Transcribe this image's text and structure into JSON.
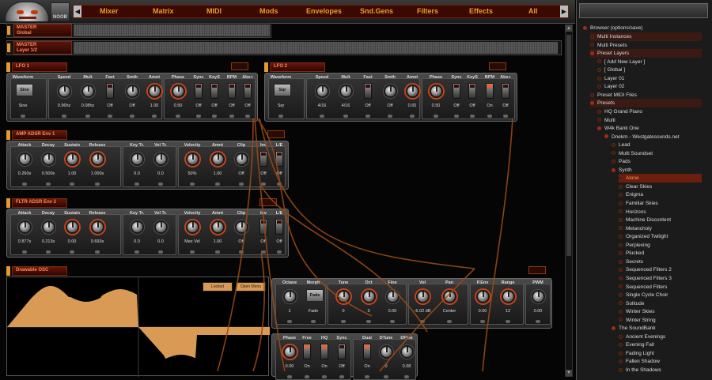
{
  "nav": {
    "items": [
      "Mixer",
      "Matrix",
      "MIDI",
      "Mods",
      "Envelopes",
      "Snd.Gens",
      "Filters",
      "Effects",
      "All"
    ],
    "logo2": "NOOB"
  },
  "master_global": {
    "line1": "MASTER",
    "line2": "Global"
  },
  "master_layer": {
    "line1": "MASTER",
    "line2": "Layer 1/2"
  },
  "lfo1": {
    "title": "LFO 1",
    "controls": [
      {
        "label": "Waveform",
        "value": "Sine",
        "button": "Sine"
      },
      {
        "label": "Speed",
        "value": "0.96hz"
      },
      {
        "label": "Mult",
        "value": "0.08hz"
      },
      {
        "label": "Fast",
        "value": "Off"
      },
      {
        "label": "Smth",
        "value": "Off"
      },
      {
        "label": "Amnt",
        "value": "1.00"
      },
      {
        "label": "Phase",
        "value": "0.50"
      },
      {
        "label": "Sync",
        "value": "Off"
      },
      {
        "label": "KeyS",
        "value": "Off"
      },
      {
        "label": "BPM",
        "value": "Off"
      },
      {
        "label": "Abs+",
        "value": "Off"
      }
    ]
  },
  "lfo2": {
    "title": "LFO 2",
    "controls": [
      {
        "label": "Waveform",
        "value": "Sqr",
        "button": "Sqr"
      },
      {
        "label": "Speed",
        "value": "4/16"
      },
      {
        "label": "Mult",
        "value": "4/16"
      },
      {
        "label": "Fast",
        "value": "Off"
      },
      {
        "label": "Smth",
        "value": "Off"
      },
      {
        "label": "Amnt",
        "value": "0.65"
      },
      {
        "label": "Phase",
        "value": "0.50"
      },
      {
        "label": "Sync",
        "value": "Off"
      },
      {
        "label": "KeyS",
        "value": "Off"
      },
      {
        "label": "BPM",
        "value": "On"
      },
      {
        "label": "Abs+",
        "value": "Off"
      }
    ]
  },
  "amp": {
    "title": "AMP ADSR Env 1",
    "controls": [
      {
        "label": "Attack",
        "value": "0.260s"
      },
      {
        "label": "Decay",
        "value": "0.500s"
      },
      {
        "label": "Sustain",
        "value": "1.00"
      },
      {
        "label": "Release",
        "value": "1.000s"
      },
      {
        "label": "Key Tr.",
        "value": "0.0"
      },
      {
        "label": "Vel Tr.",
        "value": "0.0"
      },
      {
        "label": "Velocity",
        "value": "50%"
      },
      {
        "label": "Amnt",
        "value": "1.00"
      },
      {
        "label": "Clip",
        "value": "Off"
      },
      {
        "label": "Inv",
        "value": "Off"
      },
      {
        "label": "L/E",
        "value": "Off"
      }
    ]
  },
  "fltr": {
    "title": "FLTR ADSR Env 2",
    "controls": [
      {
        "label": "Attack",
        "value": "0.877s"
      },
      {
        "label": "Decay",
        "value": "0.213s"
      },
      {
        "label": "Sustain",
        "value": "0.00"
      },
      {
        "label": "Release",
        "value": "0.693s"
      },
      {
        "label": "Key Tr.",
        "value": "0.0"
      },
      {
        "label": "Vel Tr.",
        "value": "0.0"
      },
      {
        "label": "Velocity",
        "value": "Max Vel"
      },
      {
        "label": "Amnt",
        "value": "1.00"
      },
      {
        "label": "Clip",
        "value": "Off"
      },
      {
        "label": "Inv",
        "value": "Off"
      },
      {
        "label": "L/E",
        "value": "Off"
      }
    ]
  },
  "drawable": {
    "title": "Drawable OSC",
    "locked": "Locked",
    "open_menu": "Open Menu",
    "waveform_color": "#d99a55",
    "osc_controls": [
      {
        "label": "Octave",
        "value": "1"
      },
      {
        "label": "Morph",
        "value": "Fade",
        "button": "Fade"
      },
      {
        "label": "Tune",
        "value": "0"
      },
      {
        "label": "Oct",
        "value": "3"
      },
      {
        "label": "Fine",
        "value": "0.00"
      },
      {
        "label": "Vol",
        "value": "-6.02 dB"
      },
      {
        "label": "Pan",
        "value": "Center"
      },
      {
        "label": "P.Env",
        "value": "0.00"
      },
      {
        "label": "Range",
        "value": "12"
      },
      {
        "label": "PWM",
        "value": "0.00"
      }
    ],
    "osc_controls2": [
      {
        "label": "Phase",
        "value": "0.00"
      },
      {
        "label": "Free",
        "value": "On"
      },
      {
        "label": "HQ",
        "value": "On"
      },
      {
        "label": "Sync",
        "value": "Off"
      },
      {
        "label": "Dual",
        "value": "On"
      },
      {
        "label": "DTune",
        "value": "0"
      },
      {
        "label": "DFine",
        "value": "0.08"
      }
    ]
  },
  "browser": {
    "title": "Browser (options/save)",
    "items": [
      {
        "text": "Multi Instances",
        "indent": 1,
        "open": false,
        "hl": true
      },
      {
        "text": "Multi Presets",
        "indent": 1,
        "open": false
      },
      {
        "text": "Preset Layers",
        "indent": 1,
        "open": true,
        "hl": true
      },
      {
        "text": "[ Add New Layer ]",
        "indent": 2,
        "open": false
      },
      {
        "text": "[ Global ]",
        "indent": 2,
        "open": false
      },
      {
        "text": "Layer 01",
        "indent": 2,
        "open": false
      },
      {
        "text": "Layer 02",
        "indent": 2,
        "open": false
      },
      {
        "text": "Preset MIDI Files",
        "indent": 1,
        "open": false
      },
      {
        "text": "Presets",
        "indent": 1,
        "open": true,
        "hl": true
      },
      {
        "text": "HQ Grand Piano",
        "indent": 2,
        "open": false
      },
      {
        "text": "Multi",
        "indent": 2,
        "open": false
      },
      {
        "text": "W4k Bank One",
        "indent": 2,
        "open": true
      },
      {
        "text": "Dnekm - Westgatesounds.net",
        "indent": 3,
        "open": true
      },
      {
        "text": "Lead",
        "indent": 4,
        "open": false
      },
      {
        "text": "Multi Soundset",
        "indent": 4,
        "open": false
      },
      {
        "text": "Pads",
        "indent": 4,
        "open": false
      },
      {
        "text": "Synth",
        "indent": 4,
        "open": true
      },
      {
        "text": "Alone",
        "indent": 5,
        "open": false,
        "sel": true
      },
      {
        "text": "Clear Skies",
        "indent": 5,
        "open": false
      },
      {
        "text": "Enigma",
        "indent": 5,
        "open": false
      },
      {
        "text": "Familiar Skies",
        "indent": 5,
        "open": false
      },
      {
        "text": "Horizons",
        "indent": 5,
        "open": false
      },
      {
        "text": "Machine Discontent",
        "indent": 5,
        "open": false
      },
      {
        "text": "Melancholy",
        "indent": 5,
        "open": false
      },
      {
        "text": "Organized Twilight",
        "indent": 5,
        "open": false
      },
      {
        "text": "Perplexing",
        "indent": 5,
        "open": false
      },
      {
        "text": "Plucked",
        "indent": 5,
        "open": false
      },
      {
        "text": "Secrets",
        "indent": 5,
        "open": false
      },
      {
        "text": "Sequenced Filters 2",
        "indent": 5,
        "open": false
      },
      {
        "text": "Sequenced Filters 3",
        "indent": 5,
        "open": false
      },
      {
        "text": "Sequenced Filters",
        "indent": 5,
        "open": false
      },
      {
        "text": "Single Cycle Choir",
        "indent": 5,
        "open": false
      },
      {
        "text": "Solitude",
        "indent": 5,
        "open": false
      },
      {
        "text": "Winter Skies",
        "indent": 5,
        "open": false
      },
      {
        "text": "Winter String",
        "indent": 5,
        "open": false
      },
      {
        "text": "The SoundBank",
        "indent": 4,
        "open": true
      },
      {
        "text": "Ancient Evenings",
        "indent": 5,
        "open": false
      },
      {
        "text": "Evening Fall",
        "indent": 5,
        "open": false
      },
      {
        "text": "Fading Light",
        "indent": 5,
        "open": false
      },
      {
        "text": "Fallen Shadow",
        "indent": 5,
        "open": false
      },
      {
        "text": "In the Shadows",
        "indent": 5,
        "open": false
      }
    ]
  }
}
